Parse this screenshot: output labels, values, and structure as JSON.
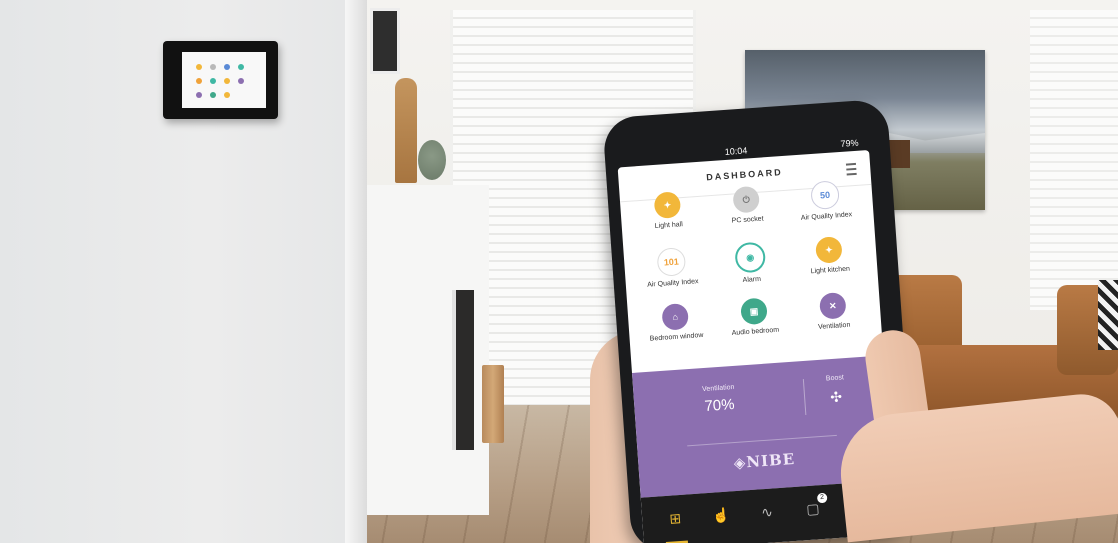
{
  "panel": {
    "brand_text": ""
  },
  "phone": {
    "status": {
      "time": "10:04",
      "battery": "79%"
    },
    "header": {
      "title": "DASHBOARD"
    },
    "tiles": [
      {
        "label": "Light hall",
        "icon": "bulb-icon",
        "value": "",
        "color": "#f2b73a"
      },
      {
        "label": "PC socket",
        "icon": "socket-icon",
        "value": "",
        "color": "#b9b9b9"
      },
      {
        "label": "Air Quality Index",
        "icon": "air-quality-icon",
        "value": "50",
        "color": "#5a8ad6"
      },
      {
        "label": "Air Quality Index",
        "icon": "air-quality-icon",
        "value": "101",
        "color": "#f0a23a"
      },
      {
        "label": "Alarm",
        "icon": "alarm-icon",
        "value": "",
        "color": "#3fb8a4"
      },
      {
        "label": "Light kitchen",
        "icon": "bulb-icon",
        "value": "",
        "color": "#f2b73a"
      },
      {
        "label": "Bedroom window",
        "icon": "window-icon",
        "value": "",
        "color": "#8c6fb0"
      },
      {
        "label": "Audio bedroom",
        "icon": "speaker-icon",
        "value": "",
        "color": "#3fa88a"
      },
      {
        "label": "Ventilation",
        "icon": "fan-icon",
        "value": "",
        "color": "#8c6fb0"
      }
    ],
    "overlay": {
      "ventilation_label": "Ventilation",
      "ventilation_value": "70%",
      "boost_label": "Boost",
      "logo": "NIBE",
      "color": "#8c6fb0"
    },
    "nav": {
      "items": [
        "dashboard-icon",
        "touch-icon",
        "chart-icon",
        "notification-icon",
        "settings-icon"
      ],
      "notification_count": "2",
      "active_color": "#e5b532"
    }
  }
}
